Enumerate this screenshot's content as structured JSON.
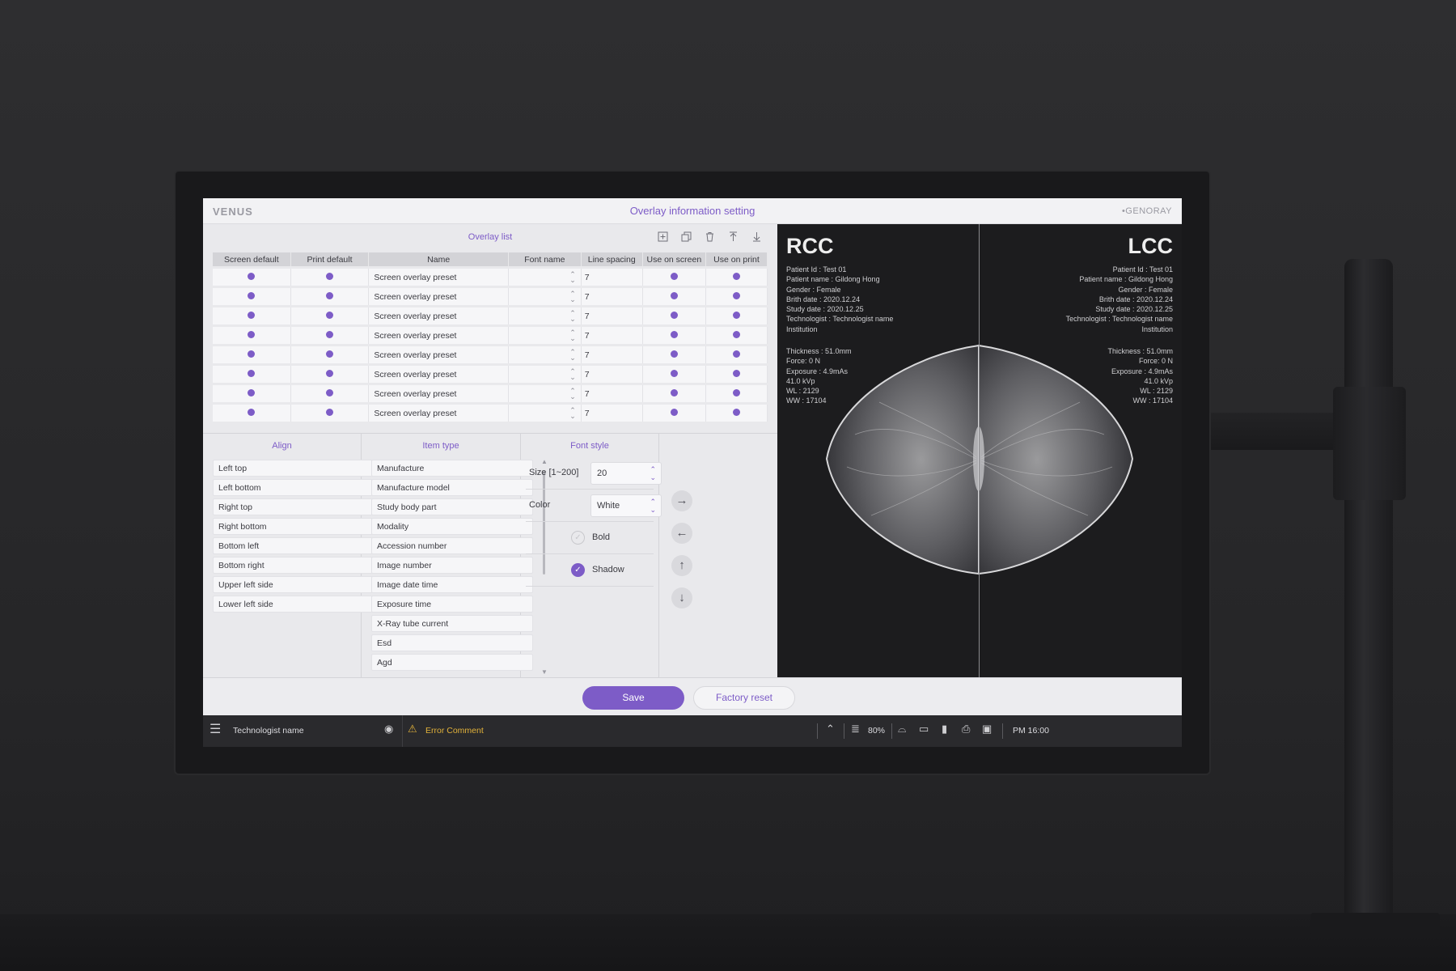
{
  "titlebar": {
    "logo": "VENUS",
    "title": "Overlay information setting",
    "brand": "GENORAY"
  },
  "overlay_list": {
    "title": "Overlay list",
    "headers": [
      "Screen default",
      "Print default",
      "Name",
      "Font name",
      "Line spacing",
      "Use on screen",
      "Use on print"
    ],
    "rows": [
      {
        "name": "Screen overlay preset",
        "spacing": "7"
      },
      {
        "name": "Screen overlay preset",
        "spacing": "7"
      },
      {
        "name": "Screen overlay preset",
        "spacing": "7"
      },
      {
        "name": "Screen overlay preset",
        "spacing": "7"
      },
      {
        "name": "Screen overlay preset",
        "spacing": "7"
      },
      {
        "name": "Screen overlay preset",
        "spacing": "7"
      },
      {
        "name": "Screen overlay preset",
        "spacing": "7"
      },
      {
        "name": "Screen overlay preset",
        "spacing": "7"
      }
    ]
  },
  "align": {
    "title": "Align",
    "items": [
      "Left top",
      "Left bottom",
      "Right top",
      "Right bottom",
      "Bottom left",
      "Bottom right",
      "Upper left side",
      "Lower left side"
    ]
  },
  "item_type": {
    "title": "Item type",
    "items": [
      "Manufacture",
      "Manufacture model",
      "Study body part",
      "Modality",
      "Accession number",
      "Image number",
      "Image date time",
      "Exposure time",
      "X-Ray tube current",
      "Esd",
      "Agd"
    ]
  },
  "font_style": {
    "title": "Font style",
    "size_label": "Size [1~200]",
    "size_value": "20",
    "color_label": "Color",
    "color_value": "White",
    "bold_label": "Bold",
    "bold_checked": false,
    "shadow_label": "Shadow",
    "shadow_checked": true
  },
  "actions": {
    "save": "Save",
    "factory_reset": "Factory reset"
  },
  "viewer": {
    "left": {
      "label": "RCC",
      "info1": [
        "Patient Id : Test 01",
        "Patient name : Gildong Hong",
        "Gender : Female",
        "Brith date : 2020.12.24",
        "Study date : 2020.12.25",
        "Technologist : Technologist name",
        "Institution"
      ],
      "info2": [
        "Thickness : 51.0mm",
        "Force: 0 N",
        "Exposure : 4.9mAs",
        "41.0 kVp",
        "WL : 2129",
        "WW : 17104"
      ]
    },
    "right": {
      "label": "LCC",
      "info1": [
        "Patient Id : Test 01",
        "Patient name : Gildong Hong",
        "Gender : Female",
        "Brith date : 2020.12.24",
        "Study date : 2020.12.25",
        "Technologist : Technologist name",
        "Institution"
      ],
      "info2": [
        "Thickness : 51.0mm",
        "Force: 0 N",
        "Exposure : 4.9mAs",
        "41.0 kVp",
        "WL : 2129",
        "WW : 17104"
      ]
    }
  },
  "statusbar": {
    "user": "Technologist name",
    "error": "Error Comment",
    "storage": "80%",
    "time": "PM 16:00"
  },
  "colors": {
    "accent": "#7d5cc7",
    "warning": "#e2b23a"
  }
}
